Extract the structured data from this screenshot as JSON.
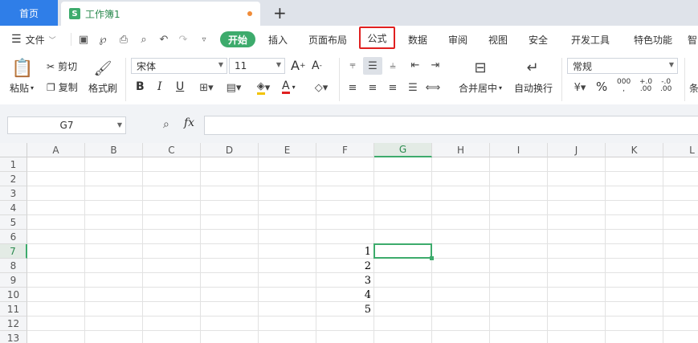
{
  "tabs": {
    "home": "首页",
    "doc_icon": "S",
    "doc_title": "工作簿1",
    "new_tab": "+"
  },
  "menu": {
    "hamburger_icon": "menu-icon",
    "file": "文件",
    "ribbon_tabs": [
      "开始",
      "插入",
      "页面布局",
      "公式",
      "数据",
      "审阅",
      "视图",
      "安全",
      "开发工具",
      "特色功能",
      "智"
    ],
    "active_tab": "开始",
    "highlighted_tab": "公式"
  },
  "ribbon": {
    "paste": "粘贴",
    "cut": "剪切",
    "copy": "复制",
    "format_painter": "格式刷",
    "font_name": "宋体",
    "font_size": "11",
    "grow_font": "A",
    "shrink_font": "A",
    "bold": "B",
    "italic": "I",
    "underline": "U",
    "font_color": "A",
    "merge_center": "合并居中",
    "wrap_text": "自动换行",
    "number_format": "常规",
    "percent": "%",
    "thousands": "000",
    "inc_decimal_top": "+.0",
    "inc_decimal_bottom": ".00",
    "dec_decimal_top": "-.0",
    "dec_decimal_bottom": ".00",
    "cutoff": "条"
  },
  "formula_bar": {
    "name_box": "G7",
    "fx": "fx",
    "formula": ""
  },
  "sheet": {
    "columns": [
      "A",
      "B",
      "C",
      "D",
      "E",
      "F",
      "G",
      "H",
      "I",
      "J",
      "K",
      "L"
    ],
    "rows": [
      "1",
      "2",
      "3",
      "4",
      "5",
      "6",
      "7",
      "8",
      "9",
      "10",
      "11",
      "12",
      "13"
    ],
    "active_column": "G",
    "active_row": "7",
    "cells": [
      {
        "ref": "F7",
        "value": "1"
      },
      {
        "ref": "F8",
        "value": "2"
      },
      {
        "ref": "F9",
        "value": "3"
      },
      {
        "ref": "F10",
        "value": "4"
      },
      {
        "ref": "F11",
        "value": "5"
      }
    ]
  },
  "colors": {
    "accent_green": "#3dab6c",
    "home_blue": "#2f7ee8",
    "highlight_red": "#e02020"
  }
}
